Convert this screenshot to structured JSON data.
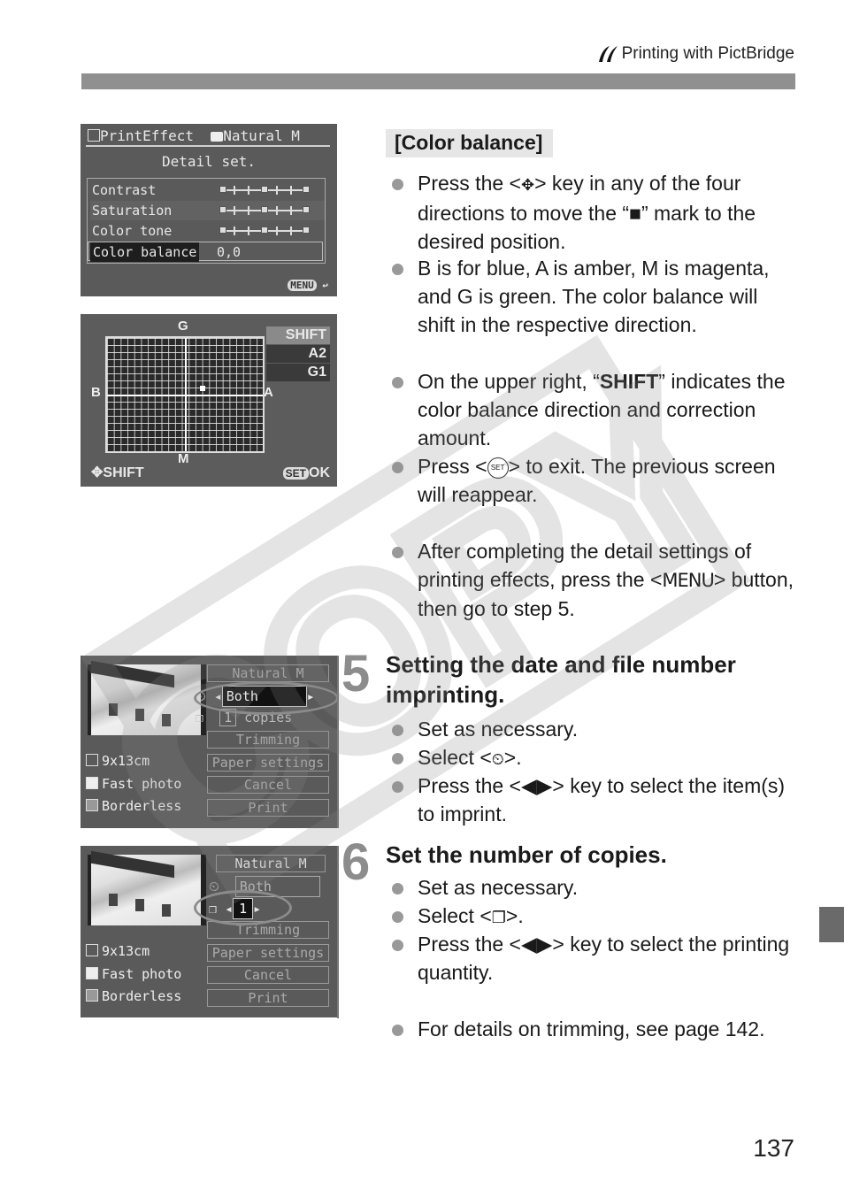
{
  "header": {
    "section_icon": "pictbridge-icon",
    "title": "Printing with PictBridge"
  },
  "screens": {
    "detail_set": {
      "title_left": "PrintEffect",
      "title_right": "Natural M",
      "subtitle": "Detail set.",
      "rows": [
        {
          "label": "Contrast",
          "slider_value": 0
        },
        {
          "label": "Saturation",
          "slider_value": 0
        },
        {
          "label": "Color tone",
          "slider_value": 0
        }
      ],
      "selected_row": {
        "label": "Color balance",
        "value": "0,0"
      },
      "footer_key": "MENU"
    },
    "color_balance": {
      "axis_top": "G",
      "axis_bottom": "M",
      "axis_left": "B",
      "axis_right": "A",
      "shift_header": "SHIFT",
      "shift_values": [
        "A2",
        "G1"
      ],
      "marker": {
        "amber": 2,
        "green": 1
      },
      "footer_left": "SHIFT",
      "footer_right_key": "SET",
      "footer_right": "OK"
    },
    "print_settings_date": {
      "effect": "Natural M",
      "date_value": "Both",
      "copies_value": "1",
      "copies_label": "copies",
      "buttons": [
        "Trimming",
        "Paper settings",
        "Cancel",
        "Print"
      ],
      "info": [
        "9x13cm",
        "Fast photo",
        "Borderless"
      ]
    },
    "print_settings_copies": {
      "effect": "Natural M",
      "date_value": "Both",
      "copies_value": "1",
      "buttons": [
        "Trimming",
        "Paper settings",
        "Cancel",
        "Print"
      ],
      "info": [
        "9x13cm",
        "Fast photo",
        "Borderless"
      ]
    }
  },
  "color_balance_section": {
    "heading": "[Color balance]",
    "bullets": [
      {
        "before": "Press the <",
        "icon": "cross-keys-icon",
        "after": "> key in any of the four directions to move the “■” mark to the desired position."
      },
      {
        "text": "B is for blue, A is amber, M is magenta, and G is green. The color balance will shift in the respective direction."
      },
      {
        "before": "On the upper right, “",
        "bold": "SHIFT",
        "after": "” indicates the color balance direction and correction amount."
      },
      {
        "before": "Press <",
        "icon": "set-button-icon",
        "icon_text": "SET",
        "after": "> to exit. The previous screen will reappear."
      }
    ],
    "note": {
      "before": "After completing the detail settings of printing effects, press the <",
      "key": "MENU",
      "after": "> button, then go to step 5."
    }
  },
  "steps": [
    {
      "number": "5",
      "title": "Setting the date and file number imprinting.",
      "bullets": [
        {
          "text": "Set as necessary."
        },
        {
          "before": "Select <",
          "icon": "date-imprint-icon",
          "after": ">."
        },
        {
          "before": "Press the <",
          "icon": "left-right-keys-icon",
          "after": "> key to select the item(s) to imprint."
        }
      ]
    },
    {
      "number": "6",
      "title": "Set the number of copies.",
      "bullets": [
        {
          "text": "Set as necessary."
        },
        {
          "before": "Select <",
          "icon": "copies-icon",
          "after": ">."
        },
        {
          "before": "Press the <",
          "icon": "left-right-keys-icon",
          "after": "> key to select the printing quantity."
        }
      ],
      "note": "For details on trimming, see page 142."
    }
  ],
  "watermark": "COPY",
  "page_number": "137",
  "colors": {
    "header_bar": "#909090",
    "bullet": "#999999",
    "step_number": "#8c8c8c",
    "side_tab": "#6a6a6a",
    "lcd_bg": "#5a5a5a"
  }
}
